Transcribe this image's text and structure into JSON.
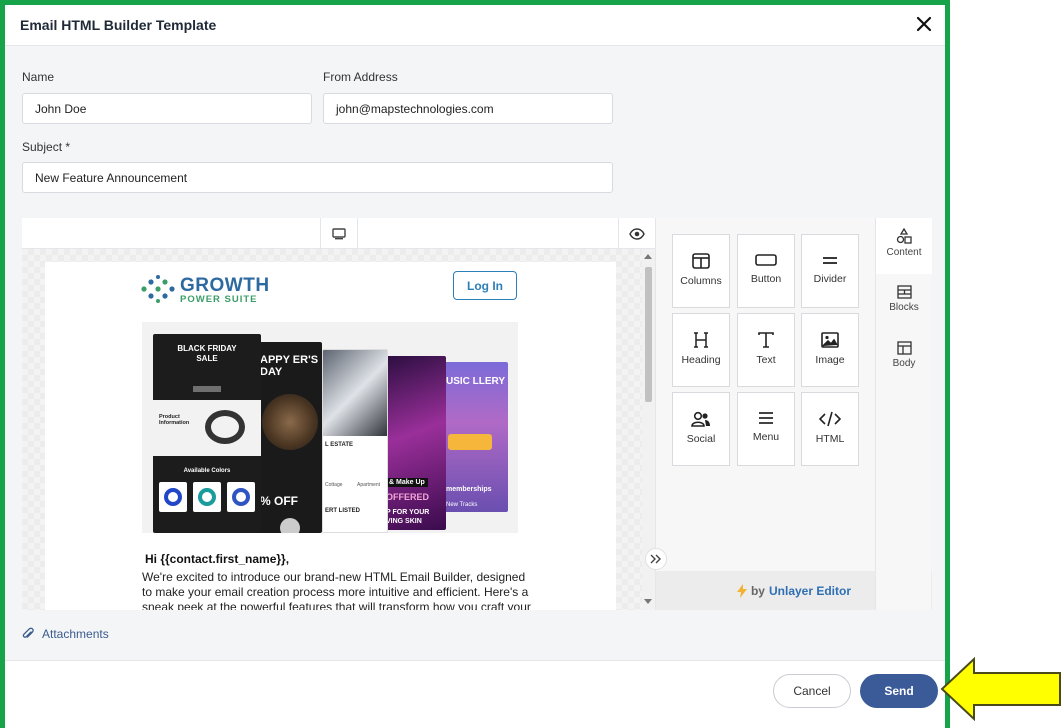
{
  "dialog": {
    "title": "Email HTML Builder Template"
  },
  "form": {
    "name_label": "Name",
    "name_value": "John Doe",
    "from_label": "From Address",
    "from_value": "john@mapstechnologies.com",
    "subject_label": "Subject *",
    "subject_value": "New Feature Announcement"
  },
  "email_preview": {
    "logo_line1": "GROWTH",
    "logo_line2": "POWER SUITE",
    "login_label": "Log In",
    "hero_cards": {
      "card1_title": "BLACK FRIDAY SALE",
      "card1_sub1": "Product Information",
      "card1_sub2": "Available Colors",
      "card2_title": "APPY ER'S DAY",
      "card2_offer": "% OFF",
      "card3_title": "L ESTATE",
      "card3_sub": "Cottage",
      "card3_sub2": "Apartment",
      "card3_list": "ERT LISTED",
      "card4_sub": "& Make Up",
      "card4_offer": "OFFERED",
      "card4_promo": "P FOR YOUR VING SKIN",
      "card5_title": "USIC LLERY",
      "card5_sub": "memberships",
      "card5_sub2": "New Tracks"
    },
    "greeting": "Hi {{contact.first_name}},",
    "body": "We're excited to introduce our brand-new HTML Email Builder, designed to make your email creation process more intuitive and efficient. Here's a sneak peek at the powerful features that will transform how you craft your email"
  },
  "tools": [
    {
      "label": "Columns",
      "icon": "columns-icon"
    },
    {
      "label": "Button",
      "icon": "button-icon"
    },
    {
      "label": "Divider",
      "icon": "divider-icon"
    },
    {
      "label": "Heading",
      "icon": "heading-icon"
    },
    {
      "label": "Text",
      "icon": "text-icon"
    },
    {
      "label": "Image",
      "icon": "image-icon"
    },
    {
      "label": "Social",
      "icon": "social-icon"
    },
    {
      "label": "Menu",
      "icon": "menu-icon"
    },
    {
      "label": "HTML",
      "icon": "html-icon"
    }
  ],
  "tabs": [
    {
      "label": "Content",
      "icon": "content-icon"
    },
    {
      "label": "Blocks",
      "icon": "blocks-icon"
    },
    {
      "label": "Body",
      "icon": "body-icon"
    }
  ],
  "powered_by": {
    "prefix": "by",
    "brand": "Unlayer Editor"
  },
  "attachments_label": "Attachments",
  "footer": {
    "cancel_label": "Cancel",
    "send_label": "Send"
  },
  "colors": {
    "frame_border": "#16a34a",
    "send_bg": "#3a5a98",
    "callout_arrow": "#ffff00"
  }
}
